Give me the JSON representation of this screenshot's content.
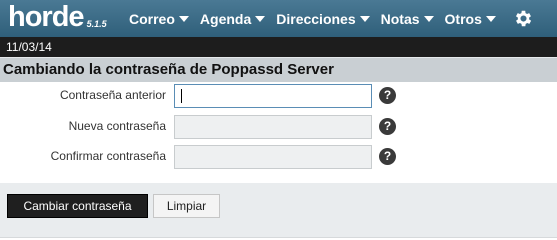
{
  "logo": {
    "word": "horde",
    "version": "5.1.5"
  },
  "menu": {
    "items": [
      {
        "label": "Correo"
      },
      {
        "label": "Agenda"
      },
      {
        "label": "Direcciones"
      },
      {
        "label": "Notas"
      },
      {
        "label": "Otros"
      }
    ],
    "settings_icon": "gear-icon"
  },
  "datebar": {
    "date": "11/03/14"
  },
  "page": {
    "title": "Cambiando la contraseña de Poppassd Server"
  },
  "form": {
    "fields": [
      {
        "label": "Contraseña anterior",
        "value": "",
        "active": true
      },
      {
        "label": "Nueva contraseña",
        "value": "",
        "active": false
      },
      {
        "label": "Confirmar contraseña",
        "value": "",
        "active": false
      }
    ],
    "help_icon": "help-icon",
    "help_glyph": "?"
  },
  "buttons": {
    "submit_label": "Cambiar contraseña",
    "reset_label": "Limpiar"
  },
  "colors": {
    "topbar": "#3d6e8a",
    "datebar": "#1d1d1d",
    "titlebar": "#c9cfd3",
    "footer": "#e9ecee",
    "input_focus": "#5a8db5"
  }
}
